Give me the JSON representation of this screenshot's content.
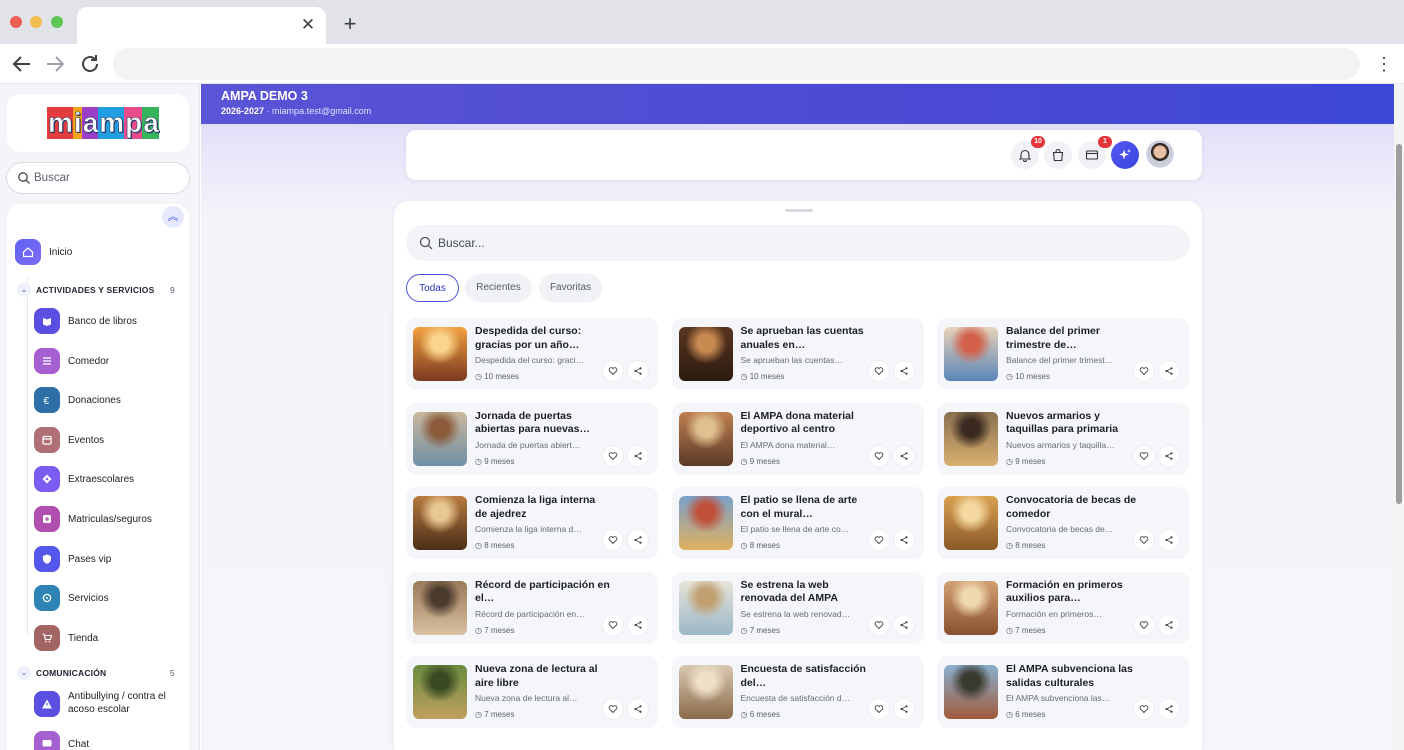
{
  "browser": {
    "tab_close": "✕",
    "new_tab": "+"
  },
  "sidebar": {
    "logo_letters": [
      "m",
      "i",
      "a",
      "m",
      "p",
      "a"
    ],
    "logo_colors": [
      "#e23c3c",
      "#f3a31a",
      "#9b3fc9",
      "#1f9fe0",
      "#e84c8a",
      "#35b35d"
    ],
    "search_placeholder": "Buscar",
    "home_label": "Inicio",
    "sections": [
      {
        "title": "ACTIVIDADES Y SERVICIOS",
        "count": "9",
        "items": [
          {
            "label": "Banco de libros",
            "icon": "book-icon",
            "color": "#5a4fe0"
          },
          {
            "label": "Comedor",
            "icon": "list-icon",
            "color": "#a65fd0"
          },
          {
            "label": "Donaciones",
            "icon": "euro-icon",
            "color": "#2f6fa8"
          },
          {
            "label": "Eventos",
            "icon": "calendar-icon",
            "color": "#b06f74"
          },
          {
            "label": "Extraescolares",
            "icon": "compass-icon",
            "color": "#7a5cf0"
          },
          {
            "label": "Matriculas/seguros",
            "icon": "plus-icon",
            "color": "#b04fb0"
          },
          {
            "label": "Pases vip",
            "icon": "shield-icon",
            "color": "#5457ea"
          },
          {
            "label": "Servicios",
            "icon": "gear-icon",
            "color": "#2e84b5"
          },
          {
            "label": "Tienda",
            "icon": "cart-icon",
            "color": "#a36464"
          }
        ]
      },
      {
        "title": "COMUNICACIÓN",
        "count": "5",
        "items": [
          {
            "label": "Antibullying / contra el acoso escolar",
            "icon": "warning-icon",
            "color": "#5a4fe0"
          },
          {
            "label": "Chat",
            "icon": "chat-icon",
            "color": "#a65fd0"
          }
        ]
      }
    ]
  },
  "header": {
    "org_name": "AMPA DEMO 3",
    "course": "2026-2027",
    "email": "· miampa.test@gmail.com"
  },
  "topbar": {
    "notifications_badge": "10",
    "cards_badge": "1"
  },
  "news": {
    "search_placeholder": "Buscar...",
    "filters": [
      "Todas",
      "Recientes",
      "Favoritas"
    ],
    "active_filter": "Todas",
    "items": [
      {
        "title": "Despedida del curso: gracias por un año…",
        "summary": "Despedida del curso: graci…",
        "time": "10 meses",
        "palette": [
          "#f2a040",
          "#7a3a20",
          "#f9d48a"
        ]
      },
      {
        "title": "Se aprueban las cuentas anuales en…",
        "summary": "Se aprueban las cuentas…",
        "time": "10 meses",
        "palette": [
          "#5a3620",
          "#2b1a10",
          "#c98a52"
        ]
      },
      {
        "title": "Balance del primer trimestre de…",
        "summary": "Balance del primer trimest…",
        "time": "10 meses",
        "palette": [
          "#e8d2b8",
          "#5a86b8",
          "#d2604a"
        ]
      },
      {
        "title": "Jornada de puertas abiertas para nuevas…",
        "summary": "Jornada de puertas abiert…",
        "time": "9 meses",
        "palette": [
          "#c9b79c",
          "#6f8fa6",
          "#8a5a3a"
        ]
      },
      {
        "title": "El AMPA dona material deportivo al centro",
        "summary": "El AMPA dona material…",
        "time": "9 meses",
        "palette": [
          "#c08050",
          "#5a3a28",
          "#e0c090"
        ]
      },
      {
        "title": "Nuevos armarios y taquillas para primaria",
        "summary": "Nuevos armarios y taquilla…",
        "time": "9 meses",
        "palette": [
          "#8a7050",
          "#d9b070",
          "#3a2a20"
        ]
      },
      {
        "title": "Comienza la liga interna de ajedrez",
        "summary": "Comienza la liga interna d…",
        "time": "8 meses",
        "palette": [
          "#b87a40",
          "#4a2e18",
          "#e8c690"
        ]
      },
      {
        "title": "El patio se llena de arte con el mural…",
        "summary": "El patio se llena de arte co…",
        "time": "8 meses",
        "palette": [
          "#7aa0c8",
          "#e0b060",
          "#c0503a"
        ]
      },
      {
        "title": "Convocatoria de becas de comedor",
        "summary": "Convocatoria de becas de…",
        "time": "8 meses",
        "palette": [
          "#d9a050",
          "#8a5a28",
          "#f4d8a0"
        ]
      },
      {
        "title": "Récord de participación en el…",
        "summary": "Récord de participación en…",
        "time": "7 meses",
        "palette": [
          "#9a7a5a",
          "#d8c0a0",
          "#4a3a2c"
        ]
      },
      {
        "title": "Se estrena la web renovada del AMPA",
        "summary": "Se estrena la web renovad…",
        "time": "7 meses",
        "palette": [
          "#e8e4d8",
          "#9ab8c8",
          "#c0a070"
        ]
      },
      {
        "title": "Formación en primeros auxilios para…",
        "summary": "Formación en primeros…",
        "time": "7 meses",
        "palette": [
          "#d0a070",
          "#8a5030",
          "#f0d8b0"
        ]
      },
      {
        "title": "Nueva zona de lectura al aire libre",
        "summary": "Nueva zona de lectura al…",
        "time": "7 meses",
        "palette": [
          "#6a8a40",
          "#c0a060",
          "#3a4a20"
        ]
      },
      {
        "title": "Encuesta de satisfacción del…",
        "summary": "Encuesta de satisfacción d…",
        "time": "6 meses",
        "palette": [
          "#d8c8b0",
          "#8a6a4a",
          "#f0e0c8"
        ]
      },
      {
        "title": "El AMPA subvenciona las salidas culturales",
        "summary": "El AMPA subvenciona las…",
        "time": "6 meses",
        "palette": [
          "#8ab0d0",
          "#a05a3a",
          "#3a3a30"
        ]
      }
    ]
  }
}
